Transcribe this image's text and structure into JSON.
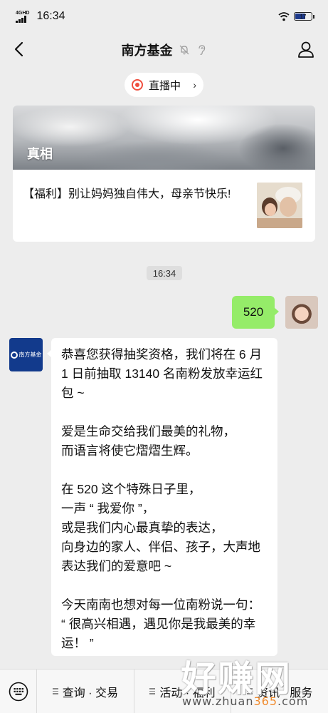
{
  "status_bar": {
    "network": "4GHD",
    "time": "16:34",
    "battery": "17"
  },
  "nav": {
    "title": "南方基金"
  },
  "live": {
    "label": "直播中"
  },
  "article": {
    "cover_title": "真相",
    "subtitle": "【福利】别让妈妈独自伟大，母亲节快乐!"
  },
  "chat": {
    "timestamp": "16:34",
    "outgoing_text": "520",
    "sender_logo_text": "南方基金",
    "incoming_paragraphs": [
      "恭喜您获得抽奖资格，我们将在 6 月 1 日前抽取 13140 名南粉发放幸运红包 ~",
      "爱是生命交给我们最美的礼物，\n而语言将使它熠熠生辉。",
      "在 520 这个特殊日子里，\n一声 “ 我爱你 ”，\n或是我们内心最真挚的表达，\n向身边的家人、伴侣、孩子，大声地表达我们的爱意吧 ~",
      "今天南南也想对每一位南粉说一句：\n“ 很高兴相遇，遇见你是我最美的幸运！ ”"
    ]
  },
  "bottom_menu": {
    "items": [
      {
        "label": "查询 · 交易"
      },
      {
        "label": "活动 · 福利"
      },
      {
        "label": "资讯 · 服务"
      }
    ]
  },
  "watermark": {
    "big": "好赚网",
    "small_prefix": "www.zhuan",
    "small_mid": "365",
    ".small_suffix": "",
    "small_tail": ".com"
  }
}
